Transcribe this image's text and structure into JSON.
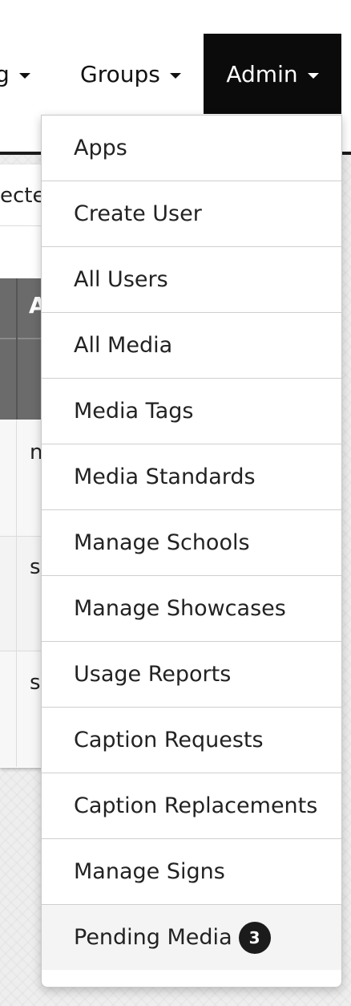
{
  "nav": {
    "partial_label": "g",
    "groups_label": "Groups",
    "admin_label": "Admin"
  },
  "background": {
    "partial_text": "ecte",
    "table_header_partial": "A",
    "rows": [
      {
        "partial": "n"
      },
      {
        "partial": "s"
      },
      {
        "partial": "s"
      }
    ]
  },
  "admin_menu": {
    "items": [
      {
        "label": "Apps"
      },
      {
        "label": "Create User"
      },
      {
        "label": "All Users"
      },
      {
        "label": "All Media"
      },
      {
        "label": "Media Tags"
      },
      {
        "label": "Media Standards"
      },
      {
        "label": "Manage Schools"
      },
      {
        "label": "Manage Showcases"
      },
      {
        "label": "Usage Reports"
      },
      {
        "label": "Caption Requests"
      },
      {
        "label": "Caption Replacements"
      },
      {
        "label": "Manage Signs"
      },
      {
        "label": "Pending Media",
        "badge": "3"
      }
    ]
  },
  "colors": {
    "active_nav_bg": "#0b0b0b",
    "badge_bg": "#1b1b1b"
  }
}
